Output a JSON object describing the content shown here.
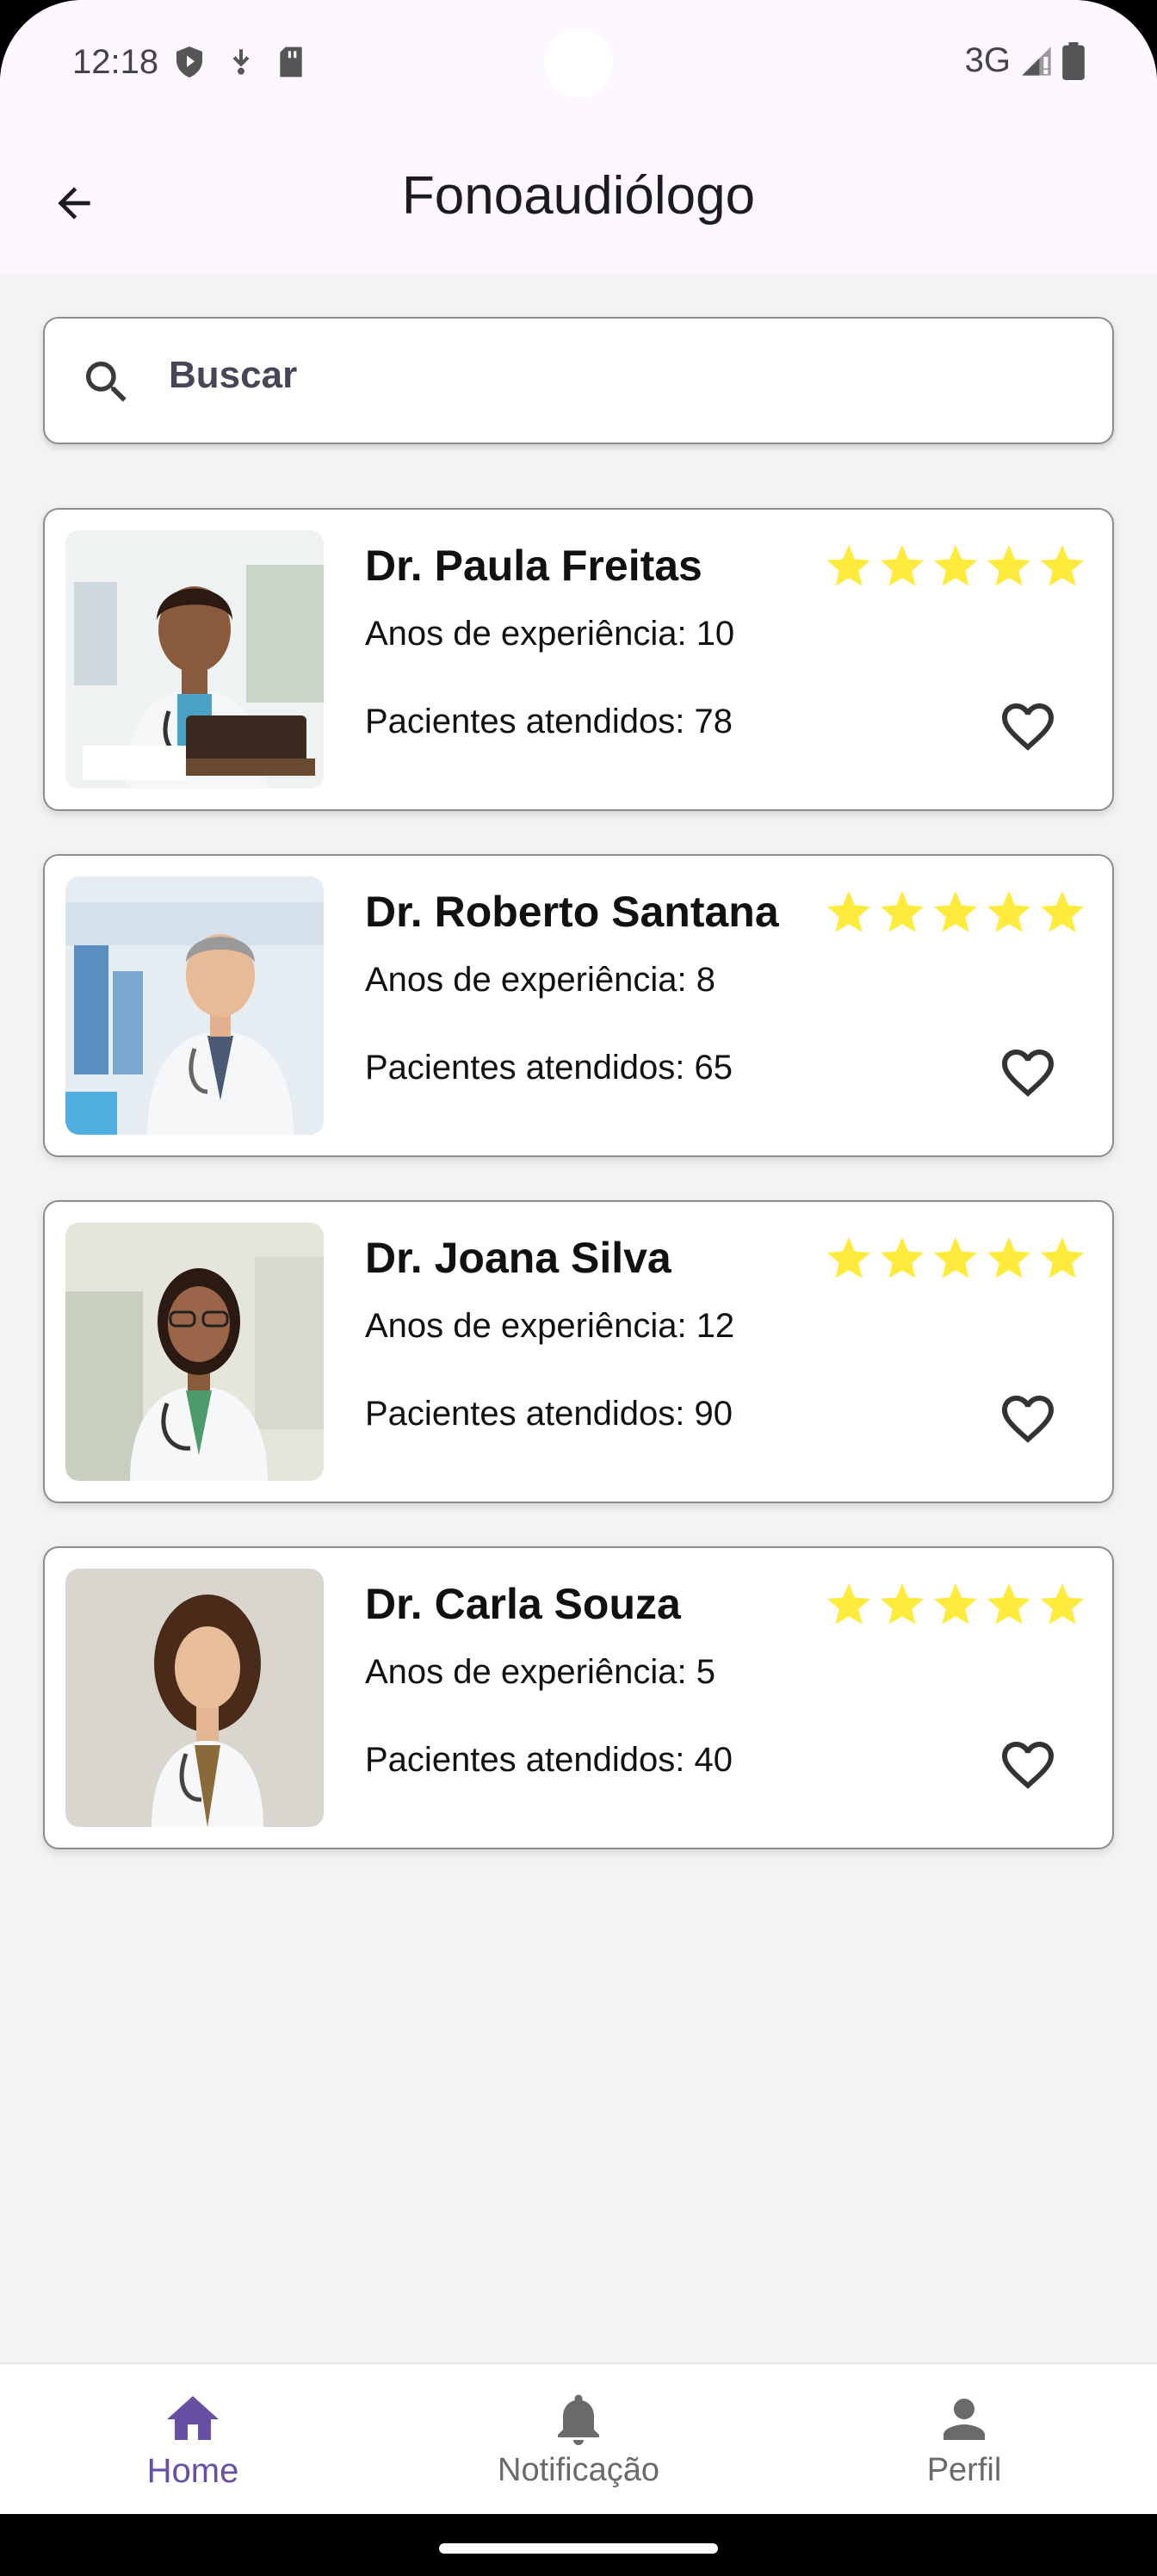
{
  "status_bar": {
    "time": "12:18",
    "network": "3G"
  },
  "app_bar": {
    "title": "Fonoaudiólogo",
    "back_icon": "arrow-back-icon"
  },
  "search": {
    "placeholder": "Buscar",
    "icon": "search-icon"
  },
  "doctors": [
    {
      "name": "Dr. Paula Freitas",
      "experience": "Anos de experiência: 10",
      "patients": "Pacientes atendidos: 78",
      "rating": 5
    },
    {
      "name": "Dr. Roberto Santana",
      "experience": "Anos de experiência: 8",
      "patients": "Pacientes atendidos: 65",
      "rating": 5
    },
    {
      "name": "Dr. Joana Silva",
      "experience": "Anos de experiência: 12",
      "patients": "Pacientes atendidos: 90",
      "rating": 5
    },
    {
      "name": "Dr. Carla Souza",
      "experience": "Anos de experiência: 5",
      "patients": "Pacientes atendidos: 40",
      "rating": 5
    }
  ],
  "bottom_nav": {
    "items": [
      {
        "label": "Home",
        "icon": "home-icon",
        "active": true
      },
      {
        "label": "Notificação",
        "icon": "bell-icon",
        "active": false
      },
      {
        "label": "Perfil",
        "icon": "person-icon",
        "active": false
      }
    ]
  },
  "colors": {
    "accent": "#6750a4",
    "star": "#ffeb3b",
    "app_bar_bg": "#fdf7ff",
    "page_bg": "#f3f3f3"
  }
}
